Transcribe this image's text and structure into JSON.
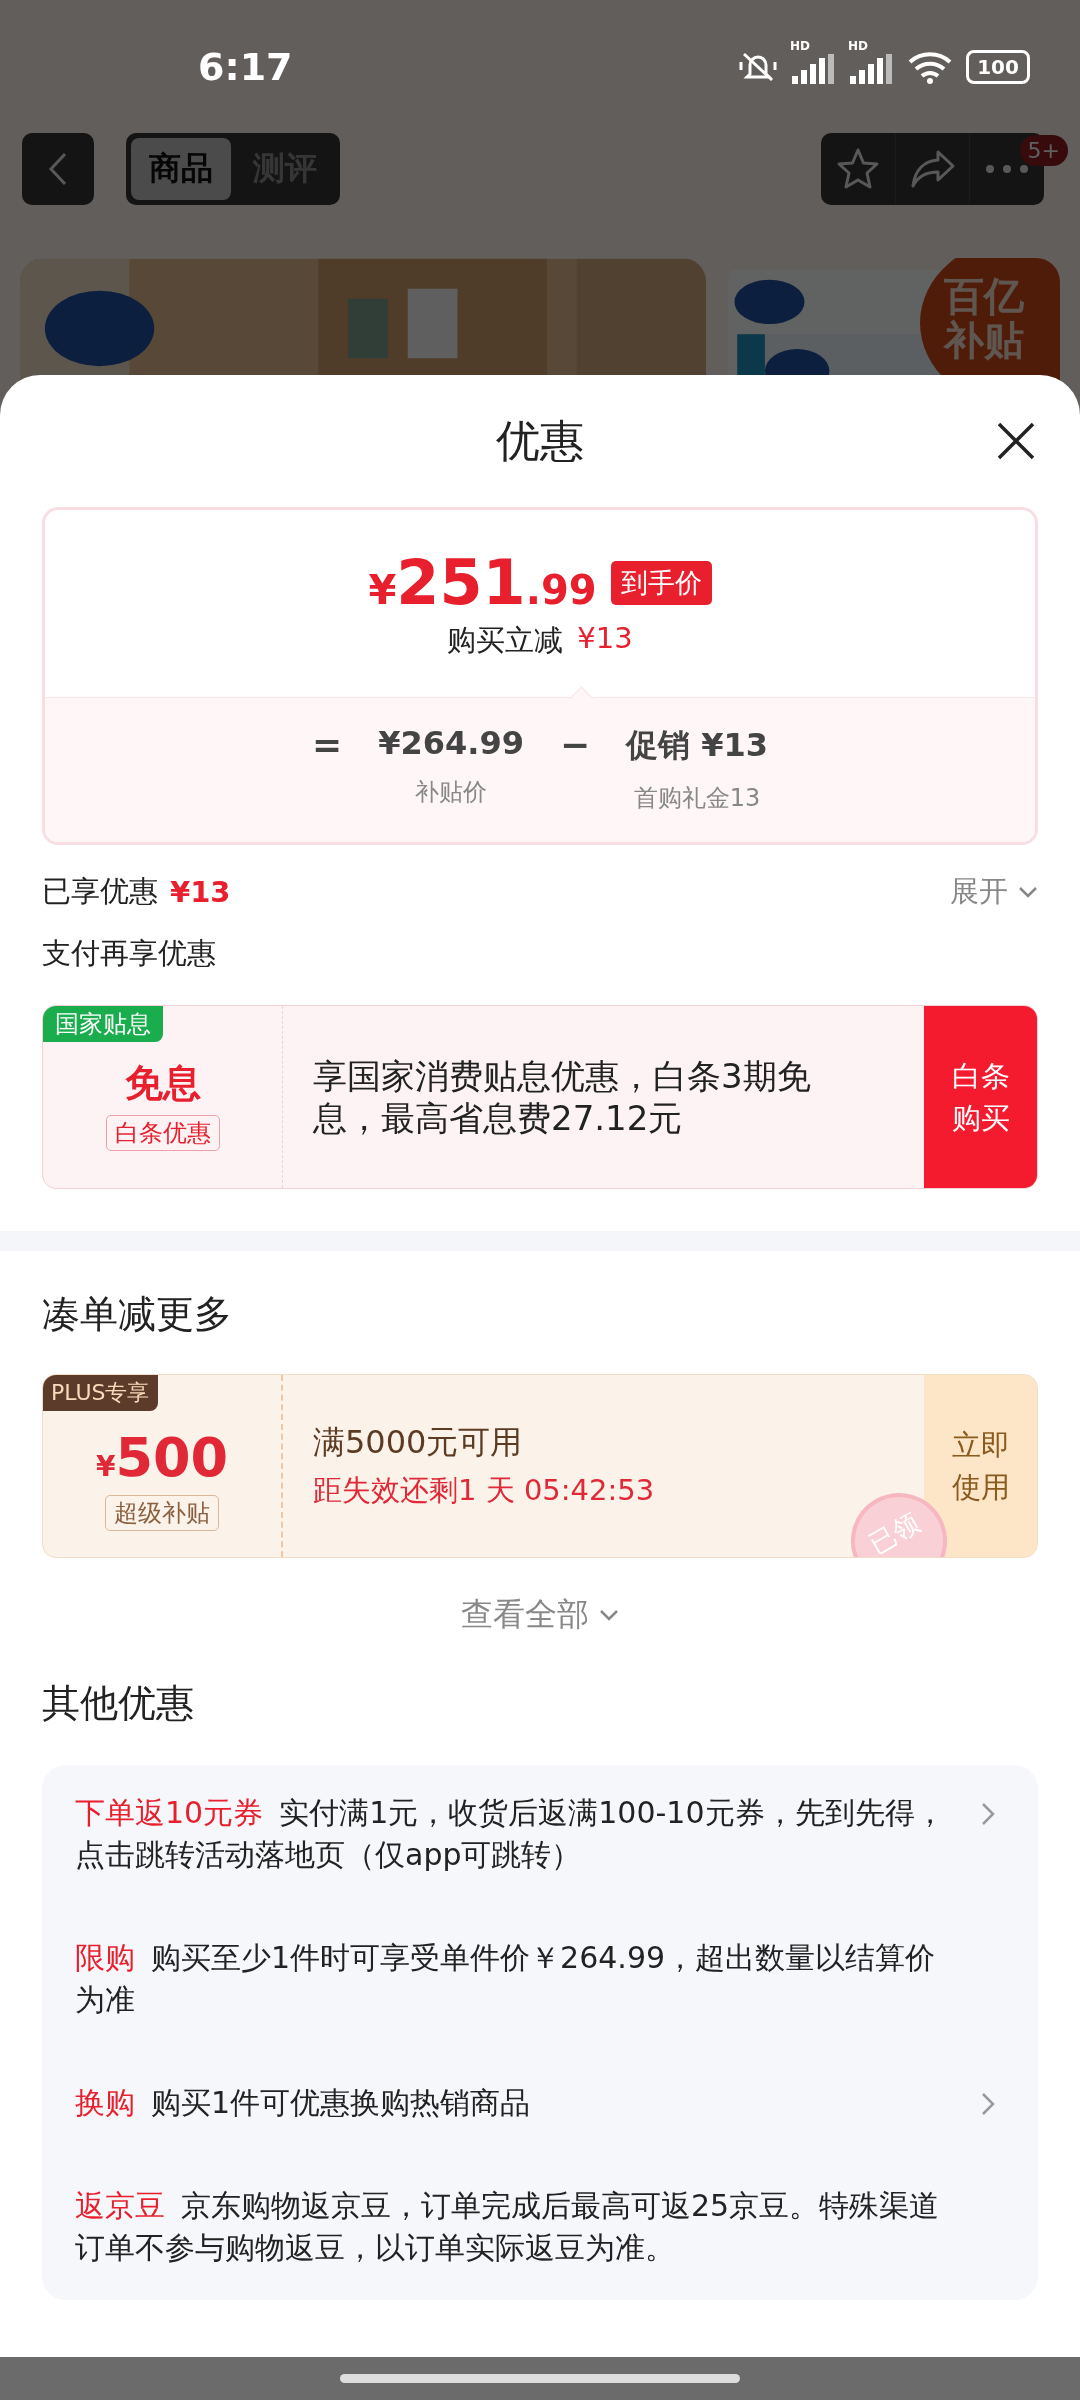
{
  "status_bar": {
    "time": "6:17",
    "signal_labels": [
      "HD",
      "HD"
    ],
    "battery": "100"
  },
  "nav": {
    "tabs": [
      {
        "label": "商品",
        "selected": true
      },
      {
        "label": "测评",
        "selected": false
      }
    ],
    "badge": "5+"
  },
  "gallery": [
    {
      "kind": "picture"
    },
    {
      "kind": "picture",
      "badge_lines": [
        "百亿",
        "补贴"
      ]
    }
  ],
  "sheet": {
    "title": "优惠"
  },
  "price_card": {
    "currency": "¥",
    "integer": "251",
    "decimal": ".99",
    "tag": "到手价",
    "subtitle": "购买立减",
    "subtitle_amount": "¥13",
    "formula": [
      {
        "kind": "op",
        "text": "="
      },
      {
        "kind": "term",
        "value": "¥264.99",
        "label": "补贴价"
      },
      {
        "kind": "op",
        "text": "−"
      },
      {
        "kind": "term",
        "value": "促销 ¥13",
        "label": "首购礼金13"
      }
    ]
  },
  "enjoyed": {
    "label": "已享优惠",
    "amount": "¥13",
    "toggle": "展开"
  },
  "pay_heading": "支付再享优惠",
  "pay_offer": {
    "ribbon": "国家贴息",
    "title": "免息",
    "tag": "白条优惠",
    "text": "享国家消费贴息优惠，白条3期免息，最高省息费27.12元",
    "button": "白条购买"
  },
  "bundle": {
    "heading": "凑单减更多",
    "coupon": {
      "ribbon": "PLUS专享",
      "currency": "¥",
      "amount": "500",
      "tag": "超级补贴",
      "condition": "满5000元可用",
      "countdown": "距失效还剩1 天 05:42:53",
      "button": "立即使用",
      "stamp": "已领"
    },
    "more": "查看全部"
  },
  "other": {
    "heading": "其他优惠",
    "items": [
      {
        "tag": "下单返10元券",
        "text": "实付满1元，收货后返满100-10元券，先到先得，点击跳转活动落地页（仅app可跳转）",
        "has_arrow": true
      },
      {
        "tag": "限购",
        "text": "购买至少1件时可享受单件价￥264.99，超出数量以结算价为准",
        "has_arrow": false
      },
      {
        "tag": "换购",
        "text": "购买1件可优惠换购热销商品",
        "has_arrow": true
      },
      {
        "tag": "返京豆",
        "text": "京东购物返京豆，订单完成后最高可返25京豆。特殊渠道订单不参与购物返豆，以订单实际返豆为准。",
        "has_arrow": false
      }
    ]
  }
}
